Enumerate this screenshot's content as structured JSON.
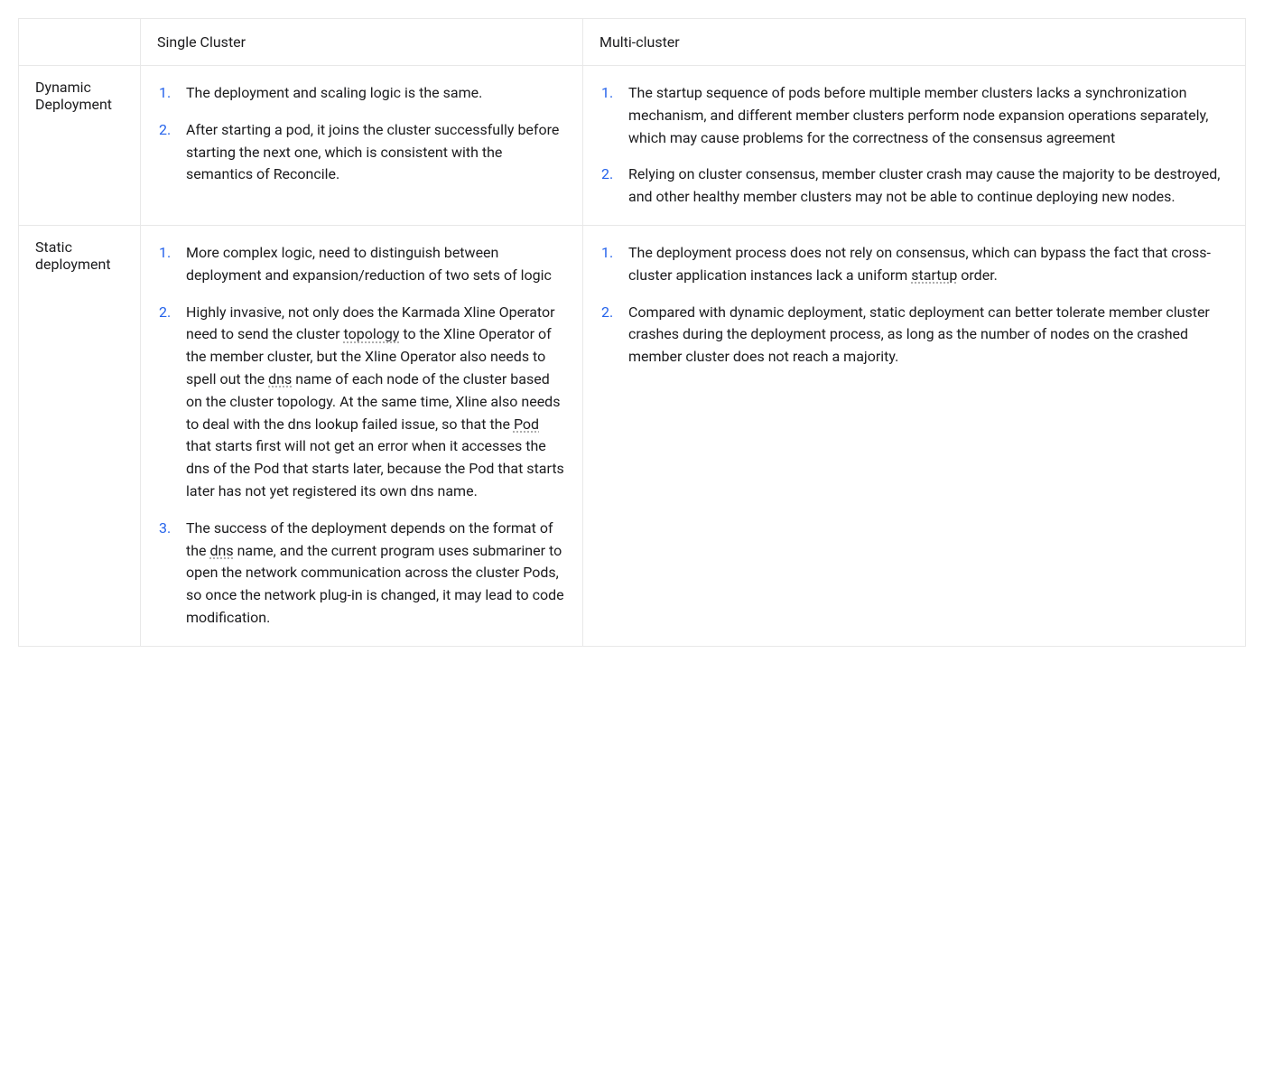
{
  "headers": {
    "blank": "",
    "single": "Single Cluster",
    "multi": "Multi-cluster"
  },
  "rows": {
    "dynamic": {
      "label": "Dynamic Deployment",
      "single": {
        "item1": "The deployment and scaling logic is the same.",
        "item2": "After starting a pod, it joins the cluster successfully before starting the next one, which is consistent with the semantics of Reconcile."
      },
      "multi": {
        "item1": "The startup sequence of pods before multiple member clusters lacks a synchronization mechanism, and different member clusters perform node expansion operations separately, which may cause problems for the correctness of the consensus agreement",
        "item2": "Relying on cluster consensus, member cluster crash may cause the majority to be destroyed, and other healthy member clusters may not be able to continue deploying new nodes."
      }
    },
    "static": {
      "label": "Static deployment",
      "single": {
        "item1": "More complex logic, need to distinguish between deployment and expansion/reduction of two sets of logic",
        "item2_pre": "Highly invasive, not only does the Karmada Xline Operator need to send the cluster ",
        "item2_topology": "topology",
        "item2_mid1": " to the Xline Operator of the member cluster, but the Xline Operator also needs to spell out the ",
        "item2_dns1": "dns",
        "item2_mid2": " name of each node of the cluster based on the cluster topology. At the same time, Xline also needs to deal with the dns lookup failed issue, so that the ",
        "item2_pod": "Pod",
        "item2_mid3": " that starts first will not get an error when it accesses the dns of the Pod that starts later, because the Pod that starts later has not yet registered its own dns name.",
        "item3_pre": "The success of the deployment depends on the format of the ",
        "item3_dns": "dns",
        "item3_post": " name, and the current program uses submariner to open the network communication across the cluster Pods, so once the network plug-in is changed, it may lead to code modification."
      },
      "multi": {
        "item1_pre": "The deployment process does not rely on consensus, which can bypass the fact that cross-cluster application instances lack a uniform ",
        "item1_startup": "startup",
        "item1_post": " order.",
        "item2": "Compared with dynamic deployment, static deployment can better tolerate member cluster crashes during the deployment process, as long as the number of nodes on the crashed member cluster does not reach a majority."
      }
    }
  }
}
